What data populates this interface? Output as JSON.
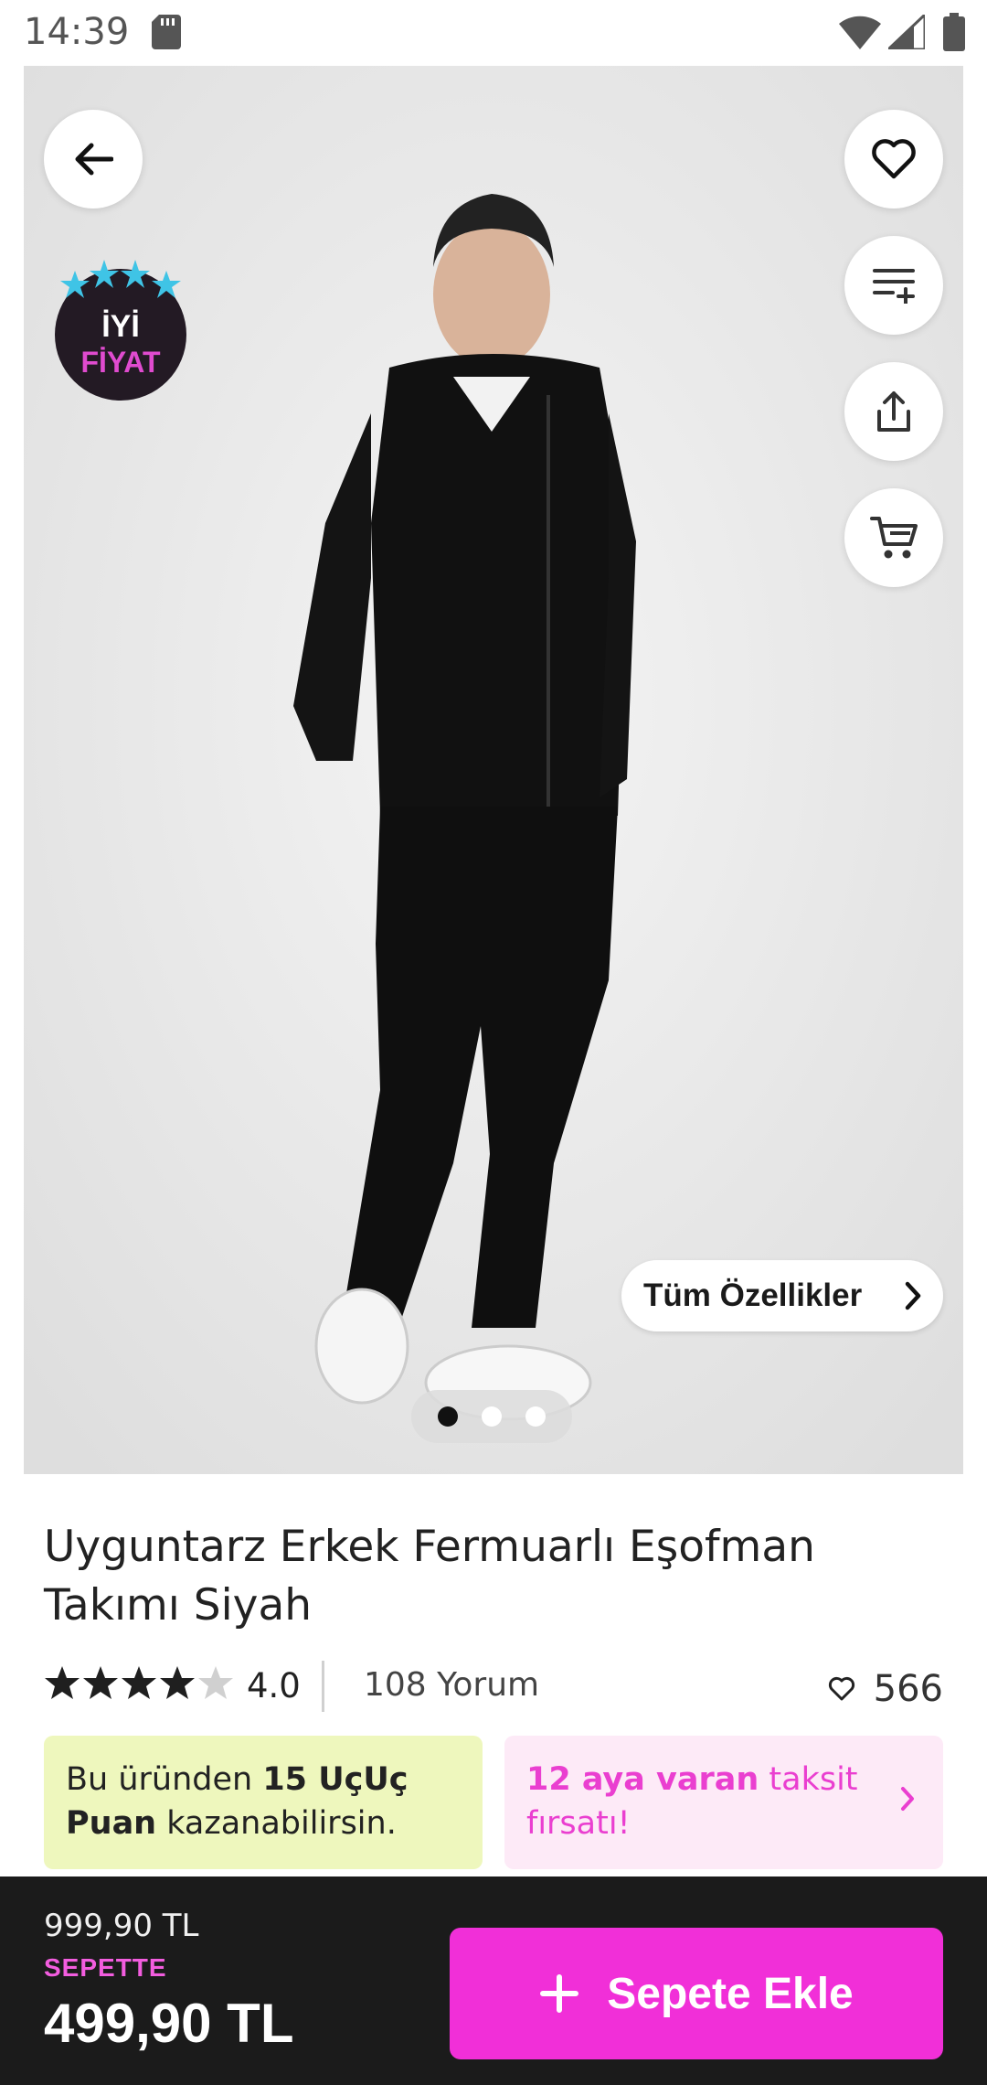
{
  "status_bar": {
    "time": "14:39"
  },
  "gallery": {
    "badge_line1": "İYİ",
    "badge_line2": "FİYAT",
    "all_features_label": "Tüm Özellikler",
    "page_count": 3,
    "active_page": 1
  },
  "product": {
    "title": "Uyguntarz Erkek Fermuarlı Eşofman Takımı Siyah",
    "rating": "4.0",
    "rating_stars": 4,
    "review_count": "108 Yorum",
    "favorite_count": "566"
  },
  "promo": {
    "points_prefix": "Bu üründen ",
    "points_bold": "15 UçUç Puan",
    "points_suffix": " kazanabilirsin.",
    "installment_bold": "12 aya varan",
    "installment_rest": " taksit fırsatı!"
  },
  "bottom_bar": {
    "old_price": "999,90 TL",
    "basket_label": "SEPETTE",
    "price": "499,90 TL",
    "add_to_cart_label": "Sepete Ekle"
  },
  "icons": {
    "back": "arrow-left-icon",
    "favorite": "heart-icon",
    "compare": "list-add-icon",
    "share": "share-icon",
    "cart": "cart-icon"
  },
  "colors": {
    "accent": "#f12fd8",
    "points_bg": "#eef7bd",
    "installment_bg": "#fdeaf7",
    "bottom_bar_bg": "#1b1b1b"
  }
}
